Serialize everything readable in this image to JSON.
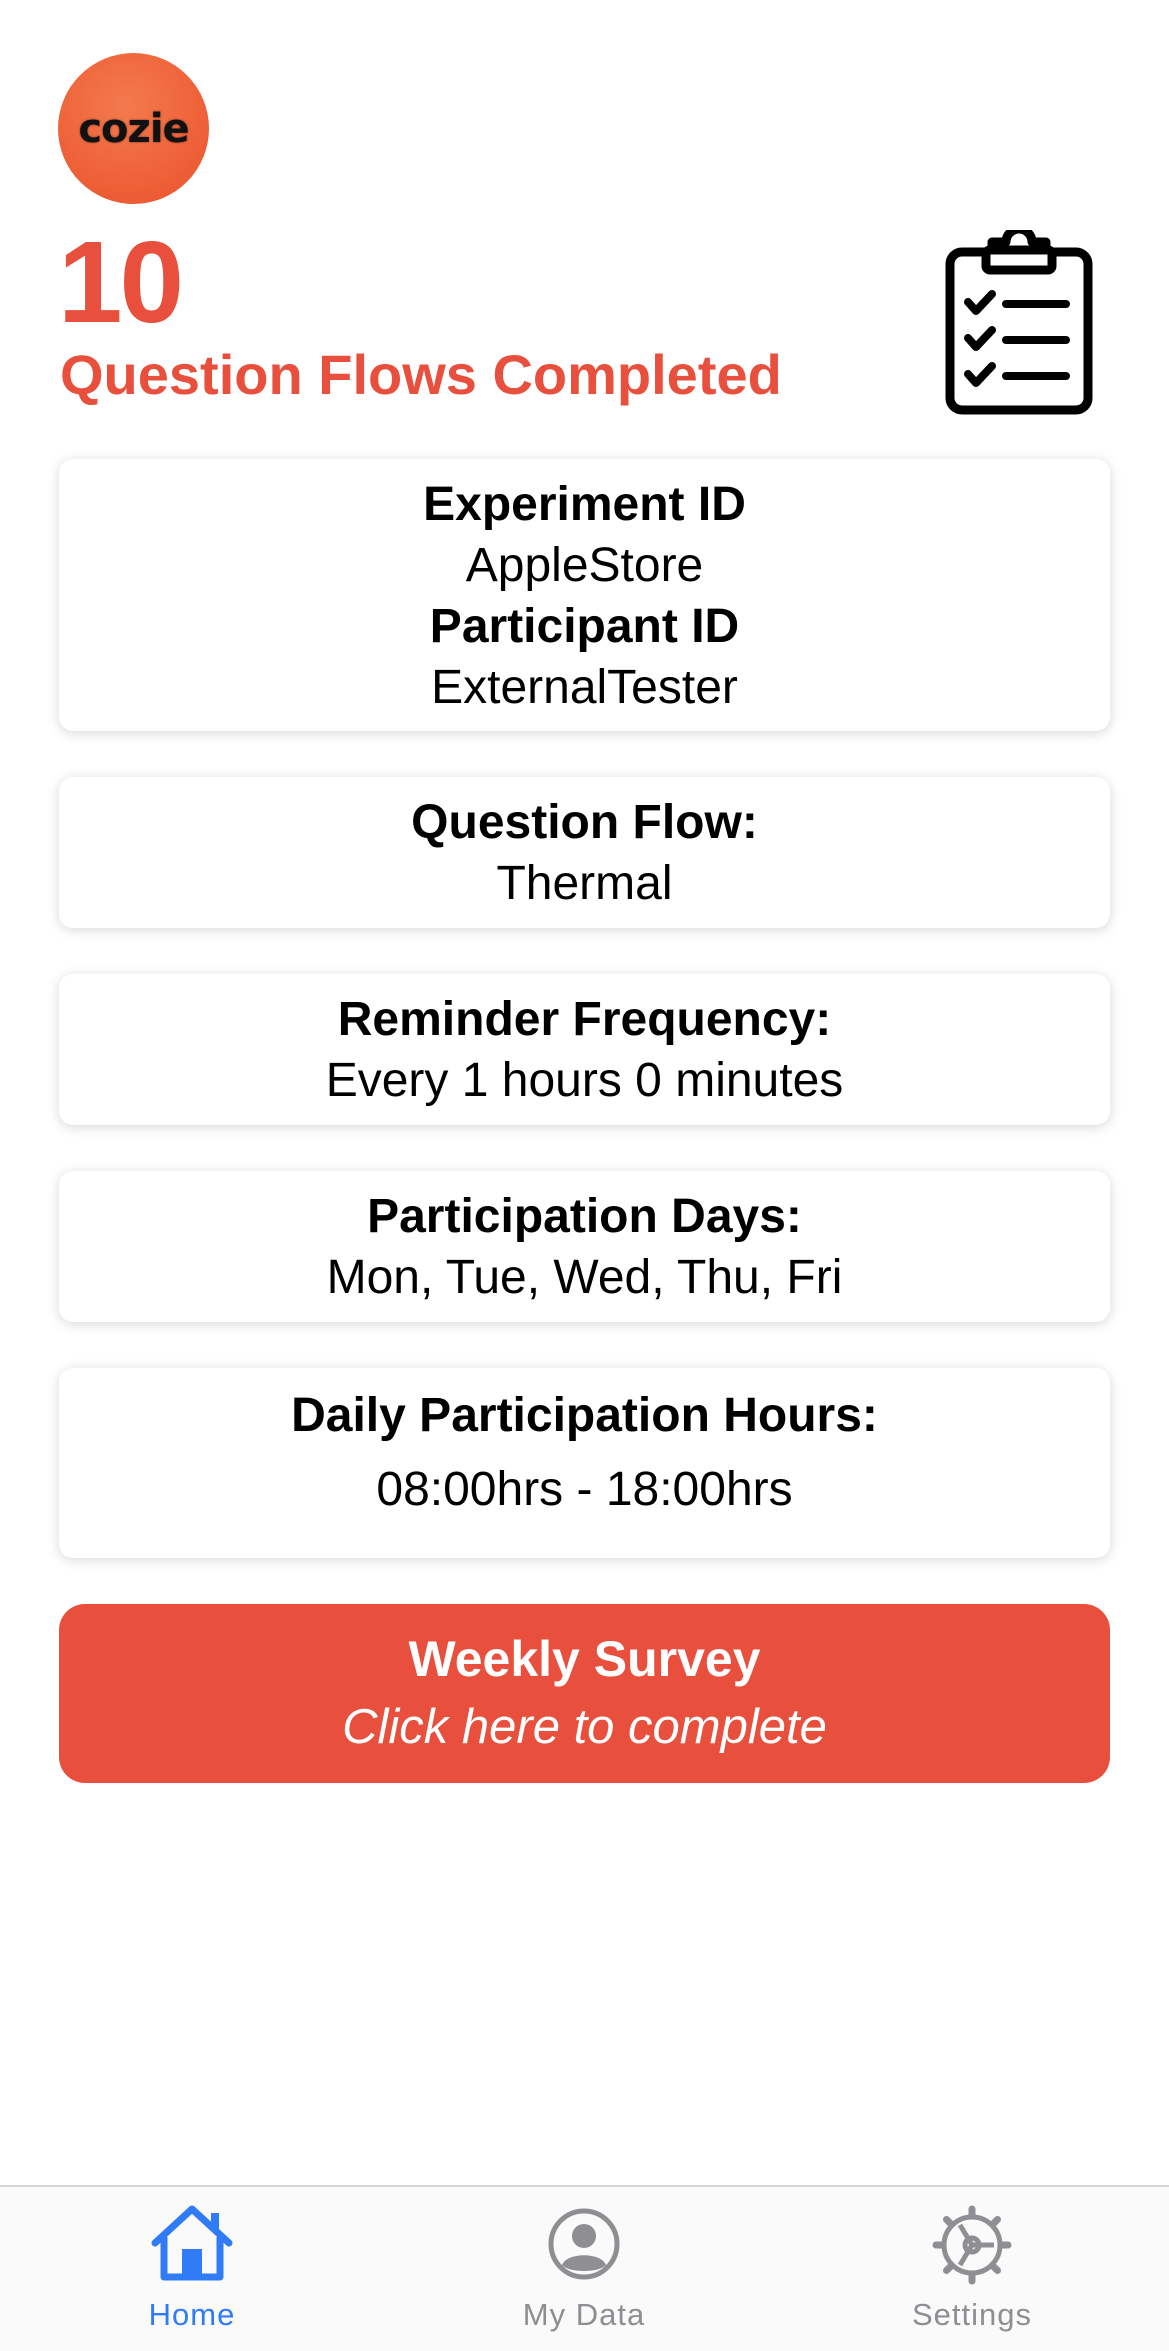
{
  "header": {
    "logo_text": "cozie",
    "completed_count": "10",
    "completed_label": "Question Flows Completed",
    "clipboard_icon": "clipboard-checklist-icon"
  },
  "cards": {
    "experiment": {
      "experiment_title": "Experiment ID",
      "experiment_value": "AppleStore",
      "participant_title": "Participant ID",
      "participant_value": "ExternalTester"
    },
    "question_flow": {
      "title": "Question Flow:",
      "value": "Thermal"
    },
    "reminder": {
      "title": "Reminder Frequency:",
      "value": "Every 1 hours 0 minutes"
    },
    "days": {
      "title": "Participation Days:",
      "value": "Mon, Tue, Wed, Thu, Fri"
    },
    "hours": {
      "title": "Daily Participation Hours:",
      "value": "08:00hrs - 18:00hrs"
    }
  },
  "survey_button": {
    "title": "Weekly Survey",
    "subtitle": "Click here to complete"
  },
  "tabbar": {
    "items": [
      {
        "label": "Home",
        "icon": "house-icon",
        "active": true
      },
      {
        "label": "My Data",
        "icon": "person-circle-icon",
        "active": false
      },
      {
        "label": "Settings",
        "icon": "gear-icon",
        "active": false
      }
    ]
  },
  "colors": {
    "accent": "#e84f3c",
    "logo": "#ef6138",
    "tab_active": "#2f7cf6",
    "tab_inactive": "#8e8e93"
  }
}
